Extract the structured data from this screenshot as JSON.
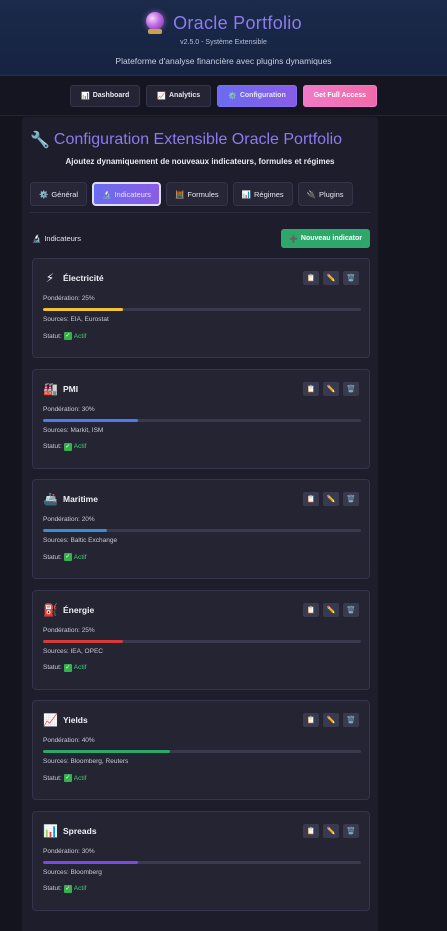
{
  "header": {
    "title": "Oracle Portfolio",
    "version": "v2.5.0 - Système Extensible",
    "tagline": "Plateforme d'analyse financière avec plugins dynamiques",
    "logo_icon": "crystal-ball-icon"
  },
  "nav": {
    "items": [
      {
        "label": "Dashboard",
        "icon": "📊"
      },
      {
        "label": "Analytics",
        "icon": "📈"
      },
      {
        "label": "Configuration",
        "icon": "⚙️"
      },
      {
        "label": "Get Full Access",
        "icon": ""
      }
    ],
    "active": "Configuration"
  },
  "config": {
    "icon": "🔧",
    "title": "Configuration Extensible Oracle Portfolio",
    "subtitle": "Ajoutez dynamiquement de nouveaux indicateurs, formules et régimes",
    "tabs": [
      {
        "label": "Général",
        "icon": "⚙️"
      },
      {
        "label": "Indicateurs",
        "icon": "🔬"
      },
      {
        "label": "Formules",
        "icon": "🧮"
      },
      {
        "label": "Régimes",
        "icon": "📊"
      },
      {
        "label": "Plugins",
        "icon": "🔌"
      }
    ],
    "active_tab": "Indicateurs"
  },
  "indicators": {
    "section_icon": "🔬",
    "section_title": "Indicateurs",
    "new_button_icon": "➕",
    "new_button": "Nouveau indicator",
    "weight_label": "Pondération:",
    "sources_label": "Sources:",
    "status_label": "Statut:",
    "status_check": "✓",
    "items": [
      {
        "icon": "⚡",
        "name": "Électricité",
        "weight": "25%",
        "weight_value": 25,
        "bar_color": "#f4c430",
        "sources": "EIA, Eurostat",
        "status": "Actif"
      },
      {
        "icon": "🏭",
        "name": "PMI",
        "weight": "30%",
        "weight_value": 30,
        "bar_color": "#4a7cf0",
        "sources": "Markit, ISM",
        "status": "Actif"
      },
      {
        "icon": "🚢",
        "name": "Maritime",
        "weight": "20%",
        "weight_value": 20,
        "bar_color": "#3a8cd8",
        "sources": "Baltic Exchange",
        "status": "Actif"
      },
      {
        "icon": "⛽",
        "name": "Énergie",
        "weight": "25%",
        "weight_value": 25,
        "bar_color": "#d83a3a",
        "sources": "IEA, OPEC",
        "status": "Actif"
      },
      {
        "icon": "📈",
        "name": "Yields",
        "weight": "40%",
        "weight_value": 40,
        "bar_color": "#2ea86a",
        "sources": "Bloomberg, Reuters",
        "status": "Actif"
      },
      {
        "icon": "📊",
        "name": "Spreads",
        "weight": "30%",
        "weight_value": 30,
        "bar_color": "#7a4ae6",
        "sources": "Bloomberg",
        "status": "Actif"
      }
    ],
    "action_icons": [
      "📋",
      "✏️",
      "🗑️"
    ]
  }
}
